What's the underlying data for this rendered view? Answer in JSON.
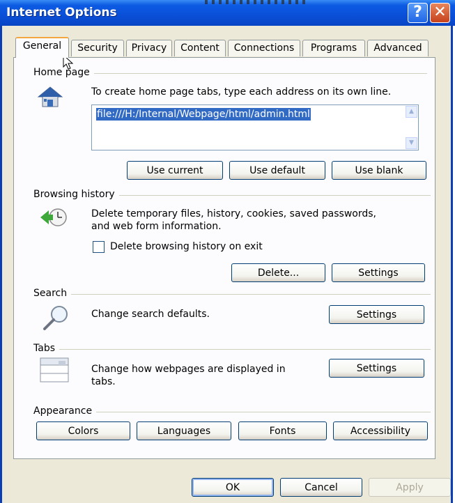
{
  "window": {
    "title": "Internet Options"
  },
  "tabs": [
    {
      "label": "General",
      "active": true
    },
    {
      "label": "Security",
      "active": false
    },
    {
      "label": "Privacy",
      "active": false
    },
    {
      "label": "Content",
      "active": false
    },
    {
      "label": "Connections",
      "active": false
    },
    {
      "label": "Programs",
      "active": false
    },
    {
      "label": "Advanced",
      "active": false
    }
  ],
  "home_page": {
    "group_title": "Home page",
    "description": "To create home page tabs, type each address on its own line.",
    "address": "file:///H:/Internal/Webpage/html/admin.html",
    "buttons": {
      "use_current": "Use current",
      "use_default": "Use default",
      "use_blank": "Use blank"
    }
  },
  "browsing_history": {
    "group_title": "Browsing history",
    "description_line1": "Delete temporary files, history, cookies, saved passwords,",
    "description_line2": "and web form information.",
    "checkbox_label": "Delete browsing history on exit",
    "checkbox_checked": false,
    "buttons": {
      "delete": "Delete...",
      "settings": "Settings"
    }
  },
  "search": {
    "group_title": "Search",
    "description": "Change search defaults.",
    "settings_label": "Settings"
  },
  "tabs_group": {
    "group_title": "Tabs",
    "description_line1": "Change how webpages are displayed in",
    "description_line2": "tabs.",
    "settings_label": "Settings"
  },
  "appearance": {
    "group_title": "Appearance",
    "buttons": {
      "colors": "Colors",
      "languages": "Languages",
      "fonts": "Fonts",
      "accessibility": "Accessibility"
    }
  },
  "dialog_buttons": {
    "ok": "OK",
    "cancel": "Cancel",
    "apply": "Apply"
  },
  "colors": {
    "titlebar": "#0a4fd8",
    "dialog_bg": "#ece9d8",
    "panel_bg": "#fcfcfe",
    "selection": "#316ac5",
    "tab_accent": "#f4a73e"
  }
}
